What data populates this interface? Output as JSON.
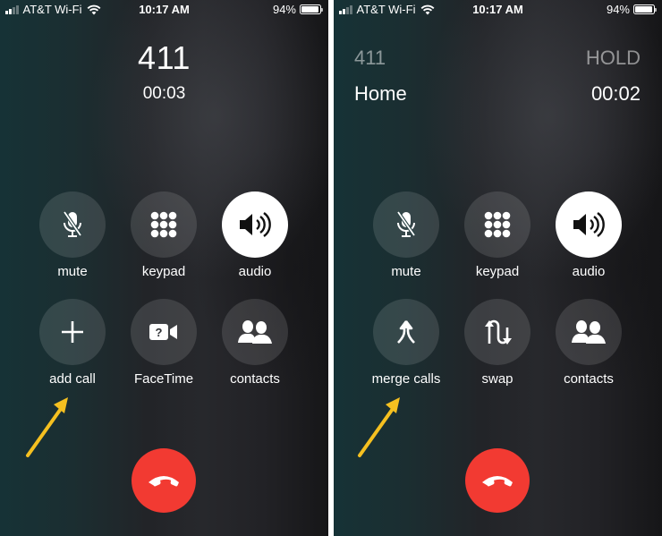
{
  "screens": [
    {
      "status_bar": {
        "carrier": "AT&T Wi-Fi",
        "time": "10:17 AM",
        "battery": "94%",
        "battery_level": 0.94,
        "signal_bars_active": 2,
        "signal_bars_total": 4
      },
      "call": {
        "number": "411",
        "timer": "00:03"
      },
      "buttons": [
        {
          "id": "mute",
          "label": "mute",
          "icon": "mic-slash-icon",
          "active": false
        },
        {
          "id": "keypad",
          "label": "keypad",
          "icon": "keypad-icon",
          "active": false
        },
        {
          "id": "audio",
          "label": "audio",
          "icon": "speaker-icon",
          "active": true
        },
        {
          "id": "add-call",
          "label": "add call",
          "icon": "plus-icon",
          "active": false
        },
        {
          "id": "facetime",
          "label": "FaceTime",
          "icon": "facetime-unavailable-icon",
          "active": false
        },
        {
          "id": "contacts",
          "label": "contacts",
          "icon": "contacts-icon",
          "active": false
        }
      ],
      "end_call": {
        "icon": "end-call-icon",
        "color": "#f23a32"
      },
      "annotation": {
        "points_to": "add call",
        "color": "#f5c020"
      }
    },
    {
      "status_bar": {
        "carrier": "AT&T Wi-Fi",
        "time": "10:17 AM",
        "battery": "94%",
        "battery_level": 0.94,
        "signal_bars_active": 2,
        "signal_bars_total": 4
      },
      "held_call": {
        "name": "411",
        "status": "HOLD"
      },
      "active_call": {
        "name": "Home",
        "timer": "00:02"
      },
      "buttons": [
        {
          "id": "mute",
          "label": "mute",
          "icon": "mic-slash-icon",
          "active": false
        },
        {
          "id": "keypad",
          "label": "keypad",
          "icon": "keypad-icon",
          "active": false
        },
        {
          "id": "audio",
          "label": "audio",
          "icon": "speaker-icon",
          "active": true
        },
        {
          "id": "merge-calls",
          "label": "merge calls",
          "icon": "merge-icon",
          "active": false
        },
        {
          "id": "swap",
          "label": "swap",
          "icon": "swap-icon",
          "active": false
        },
        {
          "id": "contacts",
          "label": "contacts",
          "icon": "contacts-icon",
          "active": false
        }
      ],
      "end_call": {
        "icon": "end-call-icon",
        "color": "#f23a32"
      },
      "annotation": {
        "points_to": "merge calls",
        "color": "#f5c020"
      }
    }
  ]
}
